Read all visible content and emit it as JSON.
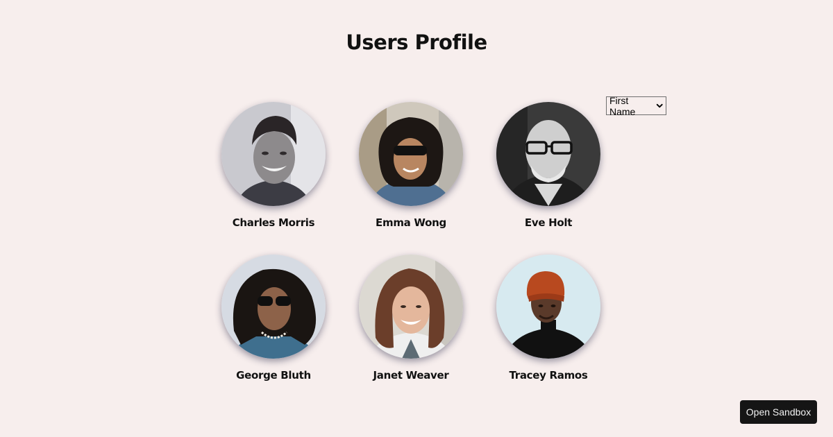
{
  "page": {
    "title": "Users Profile"
  },
  "sort": {
    "selected": "First Name",
    "icon": "chevron-down-icon"
  },
  "users": [
    {
      "name": "Charles Morris"
    },
    {
      "name": "Emma Wong"
    },
    {
      "name": "Eve Holt"
    },
    {
      "name": "George Bluth"
    },
    {
      "name": "Janet Weaver"
    },
    {
      "name": "Tracey Ramos"
    }
  ],
  "footer": {
    "sandbox_label": "Open Sandbox"
  },
  "colors": {
    "background": "#f7eeed",
    "button_bg": "#151515"
  }
}
